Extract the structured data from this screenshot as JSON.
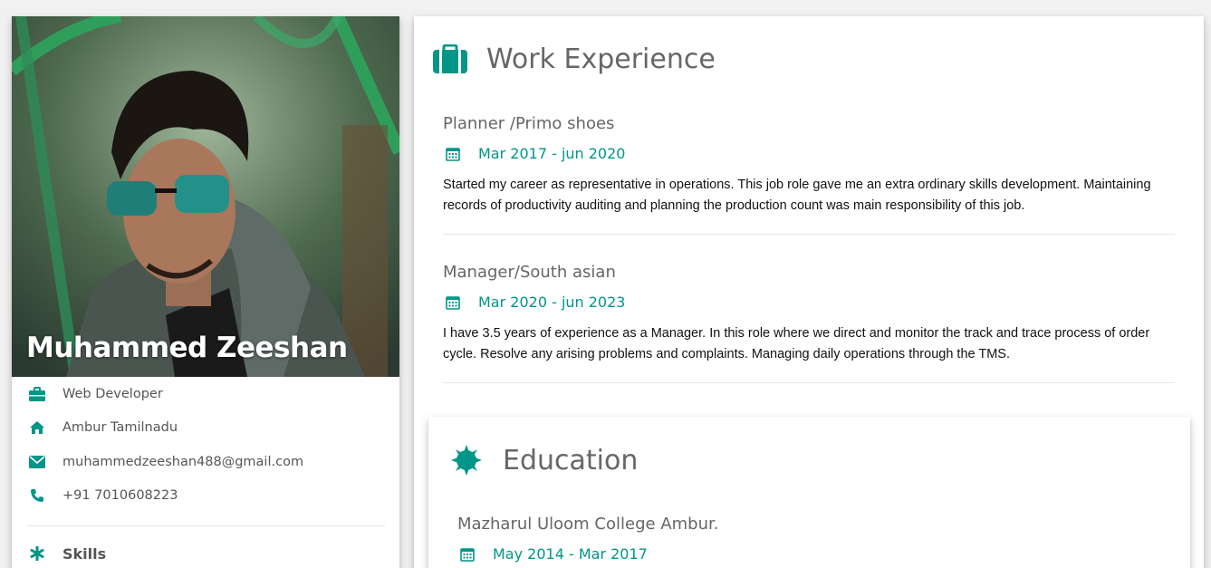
{
  "profile": {
    "name": "Muhammed Zeeshan",
    "role": "Web Developer",
    "location": "Ambur Tamilnadu",
    "email": "muhammedzeeshan488@gmail.com",
    "phone": "+91 7010608223",
    "skills_label": "Skills"
  },
  "work": {
    "title": "Work Experience",
    "jobs": [
      {
        "title": "Planner /Primo shoes",
        "date": "Mar 2017 - jun 2020",
        "desc": "Started my career as representative in operations. This job role gave me an extra ordinary skills development. Maintaining records of productivity auditing and planning the production count was main responsibility of this job."
      },
      {
        "title": "Manager/South asian",
        "date": "Mar 2020 - jun 2023",
        "desc": "I have 3.5 years of experience as a Manager. In this role where we direct and monitor the track and trace process of order cycle. Resolve any arising problems and complaints. Managing daily operations through the TMS."
      }
    ]
  },
  "education": {
    "title": "Education",
    "items": [
      {
        "title": "Mazharul Uloom College Ambur.",
        "date": "May 2014 - Mar 2017"
      }
    ]
  },
  "colors": {
    "accent": "#009688",
    "text_muted": "#666666"
  },
  "icons": {
    "role": "briefcase-icon",
    "location": "home-icon",
    "email": "envelope-icon",
    "phone": "phone-icon",
    "skills": "asterisk-icon",
    "work": "suitcase-icon",
    "education": "certificate-icon",
    "date": "calendar-icon"
  }
}
